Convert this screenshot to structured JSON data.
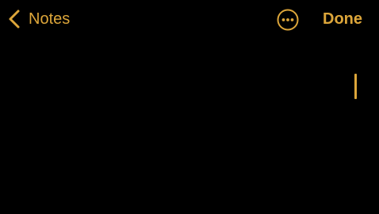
{
  "nav": {
    "back_label": "Notes",
    "done_label": "Done"
  },
  "icons": {
    "back": "chevron-left-icon",
    "more": "ellipsis-circle-icon"
  },
  "editor": {
    "text": ""
  },
  "colors": {
    "accent": "#dda63a",
    "background": "#000000"
  }
}
